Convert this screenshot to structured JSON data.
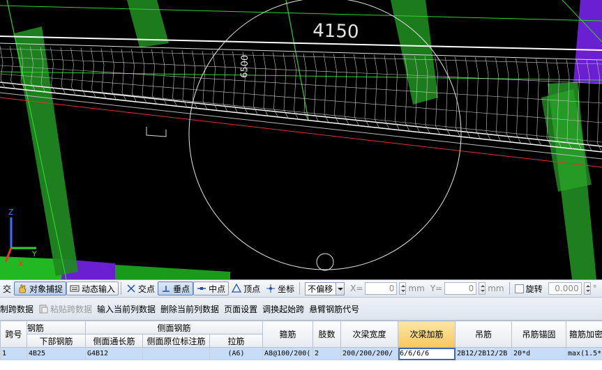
{
  "viewport": {
    "dim_top": "4150",
    "dim_vertical": "6500",
    "axis_z": "Z",
    "axis_y": "Y",
    "axis_x": "X"
  },
  "snapbar": {
    "cut_label": "交",
    "object_snap": "对象捕捉",
    "dynamic_input": "动态输入",
    "intersection": "交点",
    "perpendicular": "垂点",
    "midpoint": "中点",
    "vertex": "顶点",
    "coordinate": "坐标",
    "offset_mode": "不偏移",
    "x_label": "X=",
    "x_value": "0",
    "x_unit": "mm",
    "y_label": "Y=",
    "y_value": "0",
    "y_unit": "mm",
    "rotate_label": "旋转",
    "rotate_value": "0.000",
    "degree": "°"
  },
  "tablebar": {
    "items": [
      "复制跨数据",
      "粘贴跨数据",
      "输入当前列数据",
      "删除当前列数据",
      "页面设置",
      "调换起始跨",
      "悬臂钢筋代号"
    ]
  },
  "grid": {
    "group_headers": {
      "span_no": "跨号",
      "rebar": "钢筋",
      "side_rebar": "侧面钢筋",
      "stirrup": "箍筋",
      "legs": "肢数",
      "sec_beam_width": "次梁宽度",
      "sec_beam_add": "次梁加筋",
      "hanger": "吊筋",
      "hanger_anchor": "吊筋锚固",
      "stirrup_dense": "箍筋加密"
    },
    "sub_headers": {
      "bottom_rebar": "下部钢筋",
      "side_long": "侧面通长筋",
      "side_orig": "侧面原位标注筋",
      "tie": "拉筋"
    },
    "row": {
      "span_no": "1",
      "bottom_rebar": "4B25",
      "side_long": "G4B12",
      "side_orig": "",
      "tie": "(A6)",
      "stirrup": "A8@100/200(",
      "legs": "2",
      "sec_beam_width": "200/200/200/",
      "sec_beam_add": "6/6/6/6",
      "hanger": "2B12/2B12/2B",
      "hanger_anchor": "20*d",
      "stirrup_dense": "max(1.5*"
    }
  },
  "colors": {
    "column_green": "#1f8a1f",
    "slab_purple": "#6a1fd0",
    "axis_green": "#2fd22f",
    "highlight_header": "#f7c75f",
    "row_select": "#c7dcf6"
  }
}
